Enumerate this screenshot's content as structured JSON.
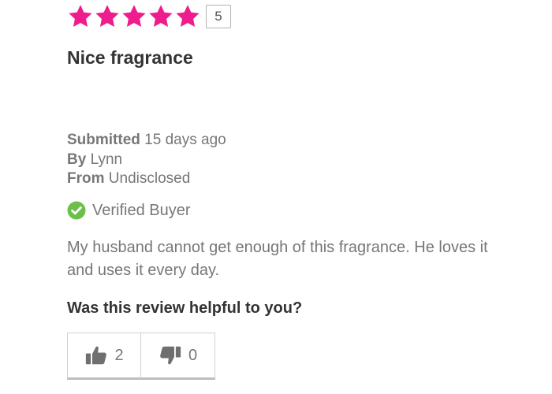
{
  "review": {
    "rating": {
      "value": 5,
      "max": 5,
      "badge_text": "5",
      "star_color": "#ee1c8c"
    },
    "title": "Nice fragrance",
    "meta": {
      "submitted_label": "Submitted",
      "submitted_value": "15 days ago",
      "by_label": "By",
      "by_value": "Lynn",
      "from_label": "From",
      "from_value": "Undisclosed"
    },
    "verified": {
      "label": "Verified Buyer",
      "icon": "check-circle-icon",
      "color": "#6cc04a"
    },
    "body": "My husband cannot get enough of this fragrance. He loves it and uses it every day.",
    "helpful": {
      "question": "Was this review helpful to you?",
      "yes_count": "2",
      "no_count": "0",
      "yes_icon": "thumbs-up-icon",
      "no_icon": "thumbs-down-icon"
    }
  }
}
